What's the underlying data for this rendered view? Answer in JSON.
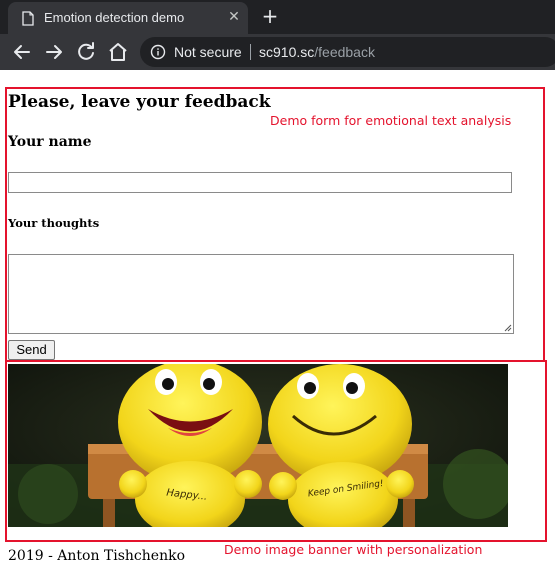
{
  "browser": {
    "tab_title": "Emotion detection demo",
    "tab_close_glyph": "✕",
    "new_tab_glyph": "+",
    "security_text": "Not secure",
    "url_host": "sc910.sc",
    "url_path": "/feedback"
  },
  "page": {
    "heading": "Please, leave your feedback",
    "name_label": "Your name",
    "name_value": "",
    "thoughts_label": "Your thoughts",
    "thoughts_value": "",
    "send_label": "Send",
    "footer": "2019 - Anton Tishchenko"
  },
  "annotations": {
    "form_note": "Demo form for emotional text analysis",
    "banner_note": "Demo image banner with personalization",
    "color": "#e4132d"
  },
  "banner_image": {
    "left_toy_text": "Happy...",
    "right_toy_text": "Keep on Smiling!"
  },
  "icons": {
    "favicon": "document-icon",
    "back": "arrow-left-icon",
    "forward": "arrow-right-icon",
    "reload": "reload-icon",
    "home": "home-icon",
    "info": "info-icon"
  }
}
